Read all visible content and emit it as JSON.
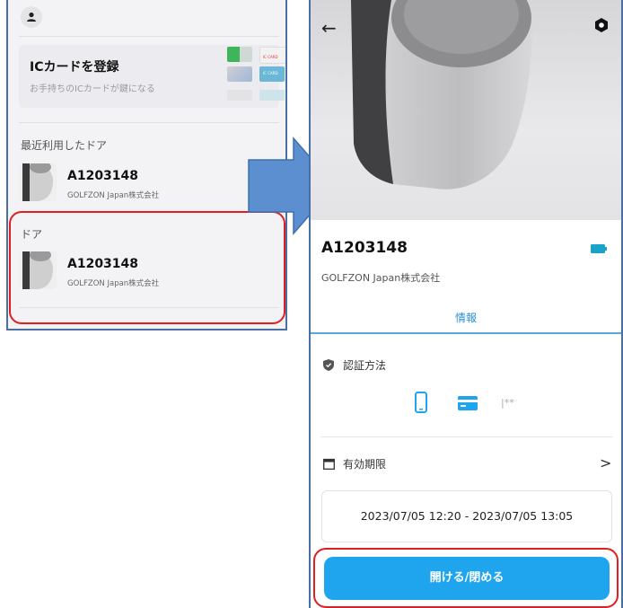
{
  "left": {
    "ic_card": {
      "title": "ICカードを登録",
      "subtitle": "お手持ちのICカードが鍵になる",
      "mini_card_labels": [
        "IC CARD",
        "IC CARD"
      ]
    },
    "recent_section_title": "最近利用したドア",
    "recent_door": {
      "name": "A1203148",
      "org": "GOLFZON Japan株式会社"
    },
    "doors_section_title": "ドア",
    "door": {
      "name": "A1203148",
      "org": "GOLFZON Japan株式会社"
    }
  },
  "right": {
    "device_name": "A1203148",
    "device_org": "GOLFZON Japan株式会社",
    "tab_info": "情報",
    "auth_label": "認証方法",
    "auth_password_glyph": "|**",
    "validity_label": "有効期限",
    "validity_period": "2023/07/05 12:20 - 2023/07/05 13:05",
    "open_close_button": "開ける/閉める"
  },
  "colors": {
    "accent_blue": "#1fa4ee",
    "highlight_red": "#e02020",
    "arrow_blue": "#5b8fd0",
    "battery_teal": "#1aa3c8"
  },
  "icons": [
    "person-icon",
    "back-arrow-icon",
    "gear-icon",
    "battery-icon",
    "shield-icon",
    "smartphone-icon",
    "card-icon",
    "calendar-icon",
    "chevron-right-icon",
    "arrow-right-icon"
  ]
}
